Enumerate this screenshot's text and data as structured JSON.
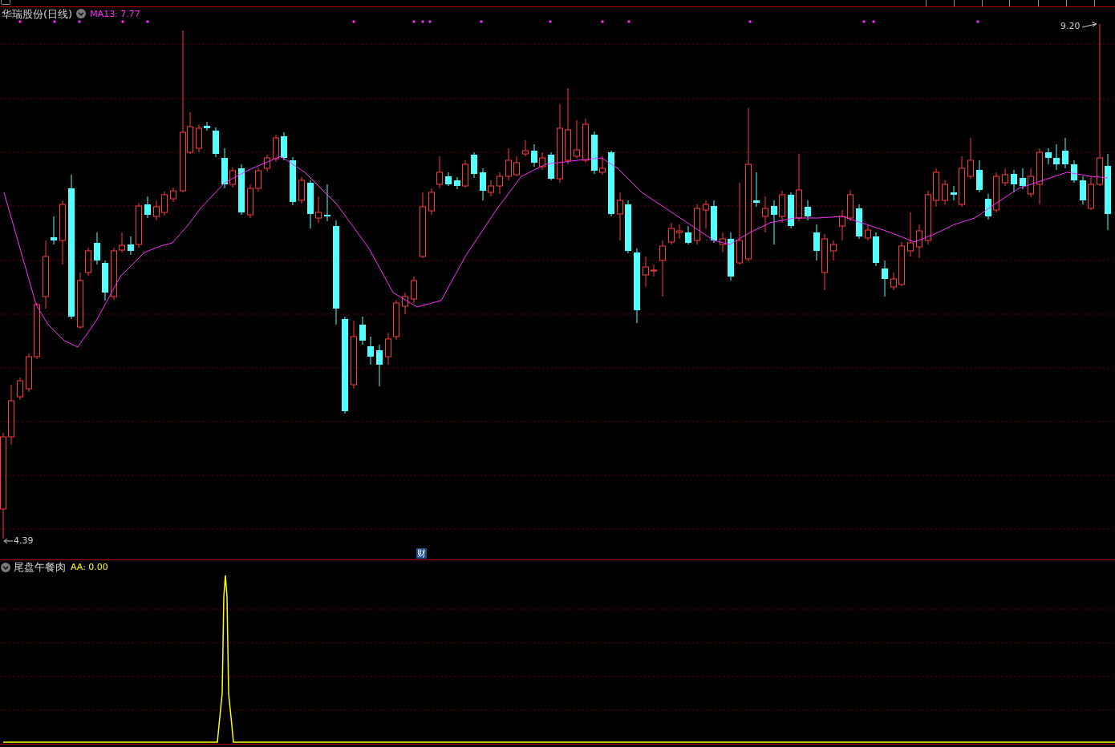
{
  "main_chart": {
    "title": "华瑞股份(日线)",
    "ma_label": "MA13: 7.77",
    "high_marker": "9.20",
    "low_marker": "4.39",
    "event_badge": "财"
  },
  "indicator_panel": {
    "title": "尾盘午餐肉",
    "aa_label": "AA: 0.00"
  }
}
